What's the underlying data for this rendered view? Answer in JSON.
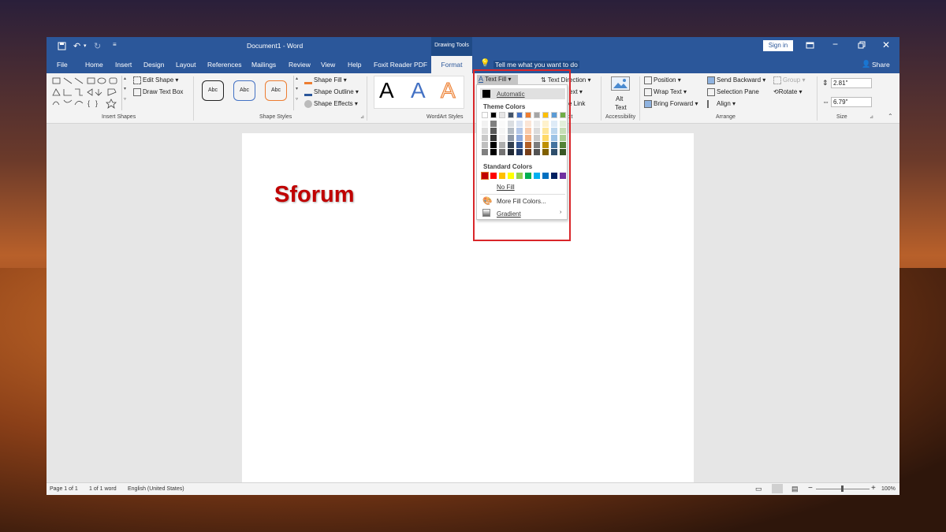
{
  "titlebar": {
    "doc_title": "Document1 - Word",
    "context": "Drawing Tools",
    "sign_in": "Sign in"
  },
  "tabs": [
    "File",
    "Home",
    "Insert",
    "Design",
    "Layout",
    "References",
    "Mailings",
    "Review",
    "View",
    "Help",
    "Foxit Reader PDF"
  ],
  "active_tab": "Format",
  "tell_me": "Tell me what you want to do",
  "share": "Share",
  "ribbon": {
    "insert_shapes": {
      "edit_shape": "Edit Shape",
      "draw_text_box": "Draw Text Box",
      "label": "Insert Shapes"
    },
    "shape_styles": {
      "preset_label": "Abc",
      "shape_fill": "Shape Fill",
      "shape_outline": "Shape Outline",
      "shape_effects": "Shape Effects",
      "label": "Shape Styles"
    },
    "wordart": {
      "glyph": "A",
      "label": "WordArt Styles"
    },
    "text": {
      "text_fill": "Text Fill",
      "text_direction": "Text Direction",
      "align_text": "ext",
      "create_link": "e Link",
      "label_tail": "xt"
    },
    "accessibility": {
      "alt_text_1": "Alt",
      "alt_text_2": "Text",
      "label": "Accessibility"
    },
    "arrange": {
      "position": "Position",
      "wrap_text": "Wrap Text",
      "bring_forward": "Bring Forward",
      "send_backward": "Send Backward",
      "selection_pane": "Selection Pane",
      "align": "Align",
      "group": "Group",
      "rotate": "Rotate",
      "label": "Arrange"
    },
    "size": {
      "height": "2.81\"",
      "width": "6.79\"",
      "label": "Size"
    }
  },
  "document": {
    "wordart_text": "Sforum"
  },
  "dropdown": {
    "automatic": "Automatic",
    "theme_colors_label": "Theme Colors",
    "standard_colors_label": "Standard Colors",
    "no_fill": "No Fill",
    "more_fill_colors": "More Fill Colors...",
    "gradient": "Gradient",
    "theme_top": [
      "#ffffff",
      "#000000",
      "#e7e6e6",
      "#44546a",
      "#4472c4",
      "#ed7d31",
      "#a5a5a5",
      "#ffc000",
      "#5b9bd5",
      "#70ad47"
    ],
    "standard": [
      "#c00000",
      "#ff0000",
      "#ffc000",
      "#ffff00",
      "#92d050",
      "#00b050",
      "#00b0f0",
      "#0070c0",
      "#002060",
      "#7030a0"
    ]
  },
  "status": {
    "page": "Page 1 of 1",
    "words": "1 of 1 word",
    "language": "English (United States)",
    "zoom": "100%"
  }
}
